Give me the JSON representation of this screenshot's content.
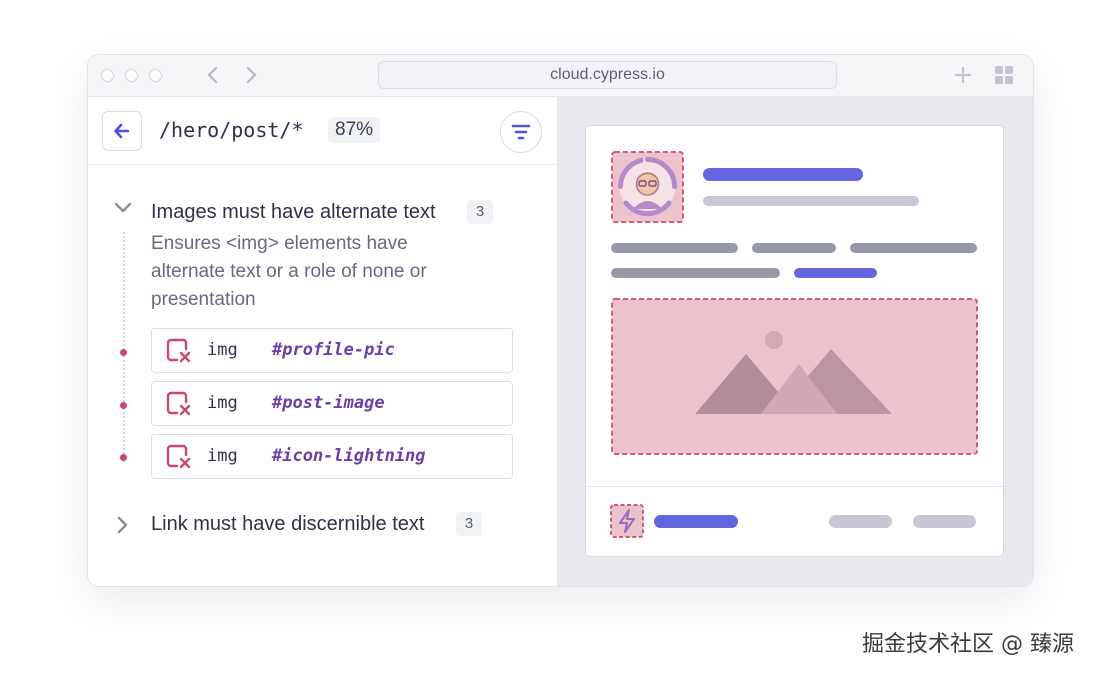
{
  "browser": {
    "url": "cloud.cypress.io"
  },
  "panel": {
    "path": "/hero/post/*",
    "score": "87%"
  },
  "rules": [
    {
      "title": "Images must have alternate text",
      "count": "3",
      "expanded": true,
      "description": "Ensures <img> elements have alternate text or a role of none or presentation",
      "violations": [
        {
          "element": "img",
          "selector": "#profile-pic"
        },
        {
          "element": "img",
          "selector": "#post-image"
        },
        {
          "element": "img",
          "selector": "#icon-lightning"
        }
      ]
    },
    {
      "title": "Link must have discernible text",
      "count": "3",
      "expanded": false
    }
  ],
  "watermark": "掘金技术社区 @ 臻源",
  "colors": {
    "accent": "#6366e0",
    "violation": "#c94a69",
    "selector": "#6b3fa8",
    "highlight_fill": "#ecc3cd",
    "skeleton_gray": "#9799a9",
    "skeleton_light": "#c7c8d3"
  }
}
